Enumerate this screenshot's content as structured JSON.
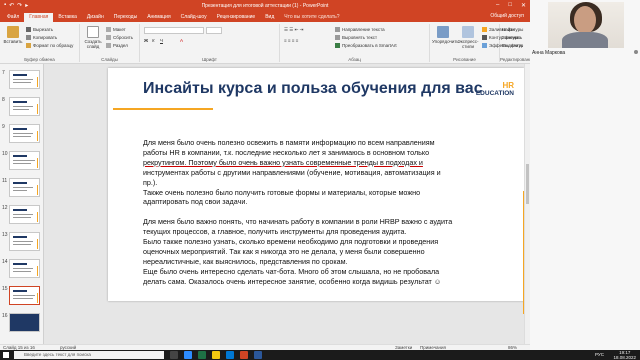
{
  "app": {
    "title": "Презентация для итоговой аттестации (1) - PowerPoint",
    "share": "Общий доступ"
  },
  "tabs": [
    "Файл",
    "Главная",
    "Вставка",
    "Дизайн",
    "Переходы",
    "Анимация",
    "Слайд-шоу",
    "Рецензирование",
    "Вид"
  ],
  "tab_search": "Что вы хотите сделать?",
  "ribbon": {
    "paste": "Вставить",
    "cut": "Вырезать",
    "copy": "Копировать",
    "format_painter": "Формат по образцу",
    "clipboard": "Буфер обмена",
    "new_slide": "Создать слайд",
    "layout": "Макет",
    "reset": "Сбросить",
    "section": "Раздел",
    "slides": "Слайды",
    "font": "Шрифт",
    "paragraph": "Абзац",
    "text_direction": "Направление текста",
    "align_text": "Выровнять текст",
    "smartart": "Преобразовать в SmartArt",
    "arrange": "Упорядочить",
    "quick_styles": "Экспресс-стили",
    "drawing": "Рисование",
    "shape_fill": "Заливка фигуры",
    "shape_outline": "Контур фигуры",
    "shape_effects": "Эффекты фигур",
    "find": "Найти",
    "replace": "Заменить",
    "select": "Выделить",
    "editing": "Редактирование"
  },
  "thumbnails": [
    "7",
    "8",
    "9",
    "10",
    "11",
    "12",
    "13",
    "14",
    "15",
    "16"
  ],
  "slide": {
    "title": "Инсайты курса и польза обучения для вас",
    "logo_hr": "HR",
    "logo_education": "EDUCATION",
    "para1": [
      "Для меня было очень полезно освежить в памяти информацию по всем направлениям",
      "работы HR в компании, т.к. последние несколько лет я занимаюсь в основном только",
      "рекрутингом. Поэтому было очень важно узнать современные тренды в подходах и",
      "инструментах работы с другими направлениями (обучение, мотивация, автоматизация и",
      "пр.).",
      "Также очень полезно было получить готовые формы и материалы, которые можно",
      "адаптировать под свои задачи."
    ],
    "para2": [
      "Для меня было важно понять, что начинать работу в компании в роли HRBP важно с аудита",
      "текущих процессов, а главное, получить инструменты для проведения аудита.",
      "Было также полезно узнать, сколько времени необходимо для подготовки и проведения",
      "оценочных мероприятий. Так как я никогда это не делала, у меня были совершенно",
      "нереалистичные, как выяснилось, представления по срокам.",
      "Еще было очень интересно сделать чат-бота. Много об этом слышала, но не пробовала",
      "делать сама. Оказалось очень интересное занятие, особенно когда видишь результат ☺"
    ]
  },
  "status": {
    "slide_of": "Слайд 15 из 16",
    "language": "русский",
    "notes": "Заметки",
    "comments": "Примечания",
    "zoom": "86%"
  },
  "taskbar": {
    "search": "Введите здесь текст для поиска",
    "lang": "РУС",
    "time": "19:17",
    "date": "18.08.2022"
  },
  "webcam": {
    "name": "Анна Маркова"
  }
}
